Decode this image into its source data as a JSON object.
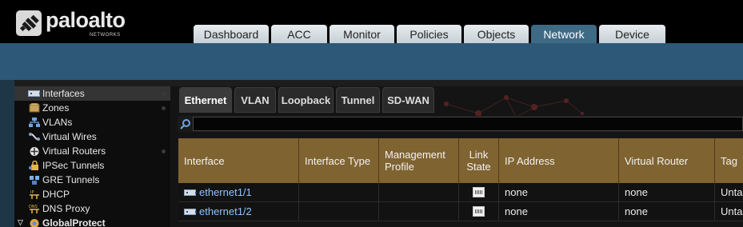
{
  "brand": {
    "name": "paloalto",
    "sub": "NETWORKS"
  },
  "top_tabs": [
    {
      "label": "Dashboard",
      "active": false
    },
    {
      "label": "ACC",
      "active": false
    },
    {
      "label": "Monitor",
      "active": false
    },
    {
      "label": "Policies",
      "active": false
    },
    {
      "label": "Objects",
      "active": false
    },
    {
      "label": "Network",
      "active": true
    },
    {
      "label": "Device",
      "active": false
    }
  ],
  "sidebar": {
    "items": [
      {
        "label": "Interfaces",
        "icon": "interfaces-icon",
        "active": true,
        "dot": true
      },
      {
        "label": "Zones",
        "icon": "zones-icon",
        "active": false,
        "dot": true
      },
      {
        "label": "VLANs",
        "icon": "vlans-icon",
        "active": false,
        "dot": false
      },
      {
        "label": "Virtual Wires",
        "icon": "virtual-wires-icon",
        "active": false,
        "dot": false
      },
      {
        "label": "Virtual Routers",
        "icon": "virtual-routers-icon",
        "active": false,
        "dot": true
      },
      {
        "label": "IPSec Tunnels",
        "icon": "ipsec-tunnels-icon",
        "active": false,
        "dot": false
      },
      {
        "label": "GRE Tunnels",
        "icon": "gre-tunnels-icon",
        "active": false,
        "dot": false
      },
      {
        "label": "DHCP",
        "icon": "dhcp-icon",
        "active": false,
        "dot": false
      },
      {
        "label": "DNS Proxy",
        "icon": "dns-proxy-icon",
        "active": false,
        "dot": false
      },
      {
        "label": "GlobalProtect",
        "icon": "globalprotect-icon",
        "active": false,
        "dot": false,
        "expandable": true
      }
    ]
  },
  "sub_tabs": [
    {
      "label": "Ethernet",
      "active": true
    },
    {
      "label": "VLAN",
      "active": false
    },
    {
      "label": "Loopback",
      "active": false
    },
    {
      "label": "Tunnel",
      "active": false
    },
    {
      "label": "SD-WAN",
      "active": false
    }
  ],
  "search": {
    "value": "",
    "placeholder": ""
  },
  "table": {
    "columns": [
      "Interface",
      "Interface Type",
      "Management Profile",
      "Link State",
      "IP Address",
      "Virtual Router",
      "Tag"
    ],
    "rows": [
      {
        "interface": "ethernet1/1",
        "type": "",
        "profile": "",
        "ip": "none",
        "router": "none",
        "tag": "Untagged"
      },
      {
        "interface": "ethernet1/2",
        "type": "",
        "profile": "",
        "ip": "none",
        "router": "none",
        "tag": "Untagged"
      }
    ]
  },
  "colors": {
    "header_band": "#2d5877",
    "active_tab": "#3e6a86",
    "table_header": "#7f6331",
    "link": "#8ec3ff"
  }
}
